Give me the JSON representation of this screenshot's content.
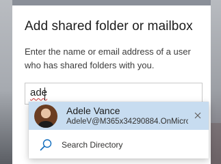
{
  "dialog": {
    "title": "Add shared folder or mailbox",
    "description": "Enter the name or email address of a user who has shared folders with you."
  },
  "search": {
    "value": "ade"
  },
  "suggestions": {
    "person": {
      "name": "Adele Vance",
      "email": "AdeleV@M365x34290884.OnMicros..."
    },
    "directory_label": "Search Directory"
  },
  "icons": {
    "remove": "close-icon",
    "directory": "search-icon"
  },
  "colors": {
    "highlight": "#c7dcf0",
    "accent": "#0f6cbd",
    "spell_error": "#d13438"
  }
}
